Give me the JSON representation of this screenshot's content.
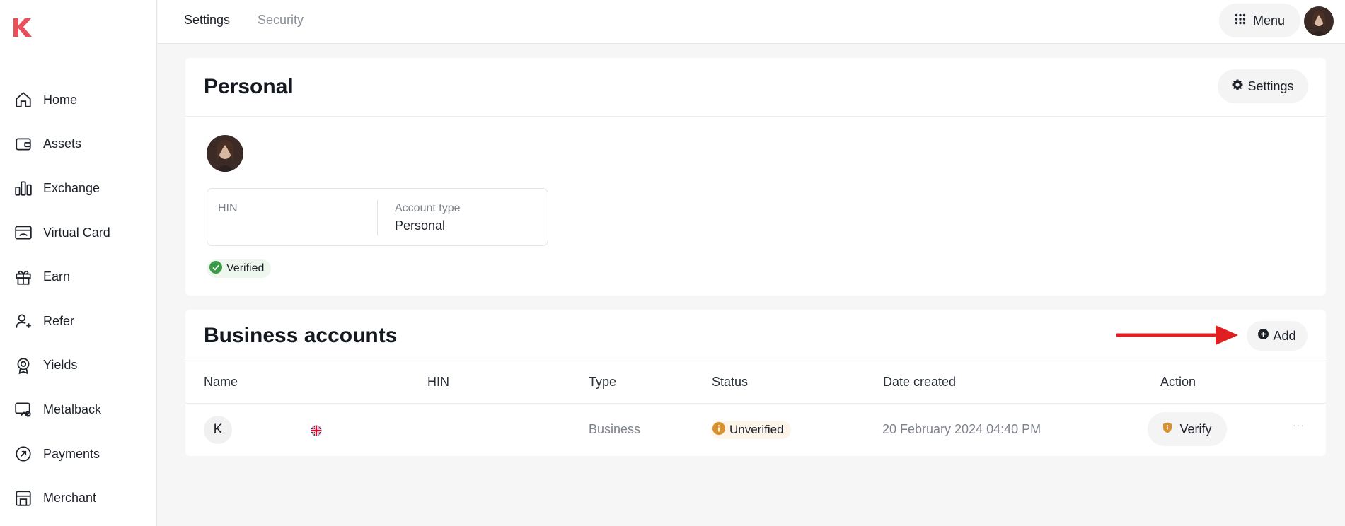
{
  "brand": {
    "logo_icon": "k-logo-icon",
    "accent": "#e8505b"
  },
  "sidebar": {
    "items": [
      {
        "label": "Home",
        "icon": "home-icon"
      },
      {
        "label": "Assets",
        "icon": "wallet-icon"
      },
      {
        "label": "Exchange",
        "icon": "exchange-bars-icon"
      },
      {
        "label": "Virtual Card",
        "icon": "card-icon"
      },
      {
        "label": "Earn",
        "icon": "gift-icon"
      },
      {
        "label": "Refer",
        "icon": "user-plus-icon"
      },
      {
        "label": "Yields",
        "icon": "badge-icon"
      },
      {
        "label": "Metalback",
        "icon": "metalback-icon"
      },
      {
        "label": "Payments",
        "icon": "payments-icon"
      },
      {
        "label": "Merchant",
        "icon": "store-icon"
      }
    ]
  },
  "header": {
    "tabs": [
      {
        "label": "Settings"
      },
      {
        "label": "Security"
      }
    ],
    "menu_label": "Menu"
  },
  "personal": {
    "title": "Personal",
    "settings_label": "Settings",
    "hin_label": "HIN",
    "hin_value": "",
    "account_type_label": "Account type",
    "account_type_value": "Personal",
    "verified_label": "Verified"
  },
  "business": {
    "title": "Business accounts",
    "add_label": "Add",
    "columns": [
      "Name",
      "HIN",
      "Type",
      "Status",
      "Date created",
      "Action"
    ],
    "rows": [
      {
        "initial": "K",
        "type": "Business",
        "status": "Unverified",
        "date": "20 February 2024 04:40 PM",
        "action": "Verify",
        "more": "···"
      }
    ]
  },
  "colors": {
    "verified": "#3a9a45",
    "unverified": "#d9902e",
    "arrow": "#e02020"
  }
}
